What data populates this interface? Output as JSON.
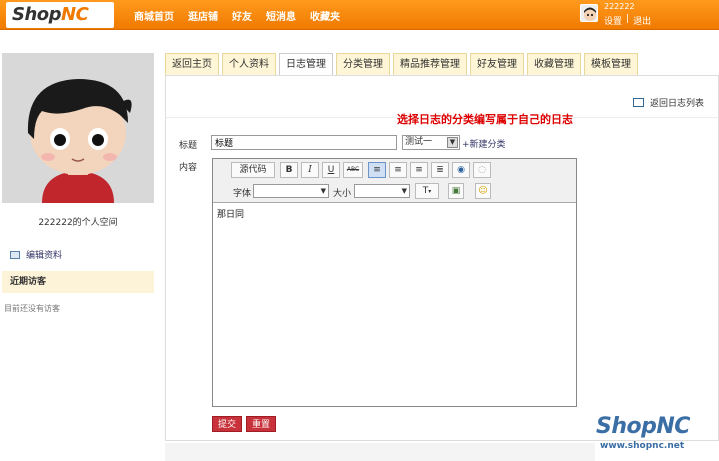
{
  "header": {
    "logo_text": "Shop",
    "logo_accent": "NC",
    "nav": [
      "商城首页",
      "逛店铺",
      "好友",
      "短消息",
      "收藏夹"
    ],
    "username": "222222",
    "links": [
      "设置",
      "|",
      "退出"
    ]
  },
  "sidebar": {
    "space_title": "222222的个人空间",
    "edit_profile": "编辑资料",
    "recent_visitors": "近期访客",
    "no_visitors": "目前还没有访客"
  },
  "tabs": [
    "返回主页",
    "个人资料",
    "日志管理",
    "分类管理",
    "精品推荐管理",
    "好友管理",
    "收藏管理",
    "模板管理"
  ],
  "active_tab": 2,
  "panel": {
    "back_to_list": "返回日志列表",
    "annotation": "选择日志的分类编写属于自己的日志",
    "title_label": "标题",
    "title_value": "标题",
    "category_value": "测试一",
    "new_category": "+新建分类",
    "content_label": "内容",
    "editor": {
      "source_button": "源代码",
      "bold": "B",
      "italic": "I",
      "underline": "U",
      "strike": "ABC",
      "font_label": "字体",
      "size_label": "大小",
      "body_text": "那日同"
    },
    "submit": "提交",
    "reset": "重置"
  },
  "brand": {
    "name": "ShopNC",
    "url": "www.shopnc.net"
  },
  "colors": {
    "topbar": "#f07a00",
    "tab_bg": "#fef6d6",
    "button_red": "#c8323a",
    "annotation_red": "#dd0000",
    "brand_blue": "#3a6ea5"
  }
}
